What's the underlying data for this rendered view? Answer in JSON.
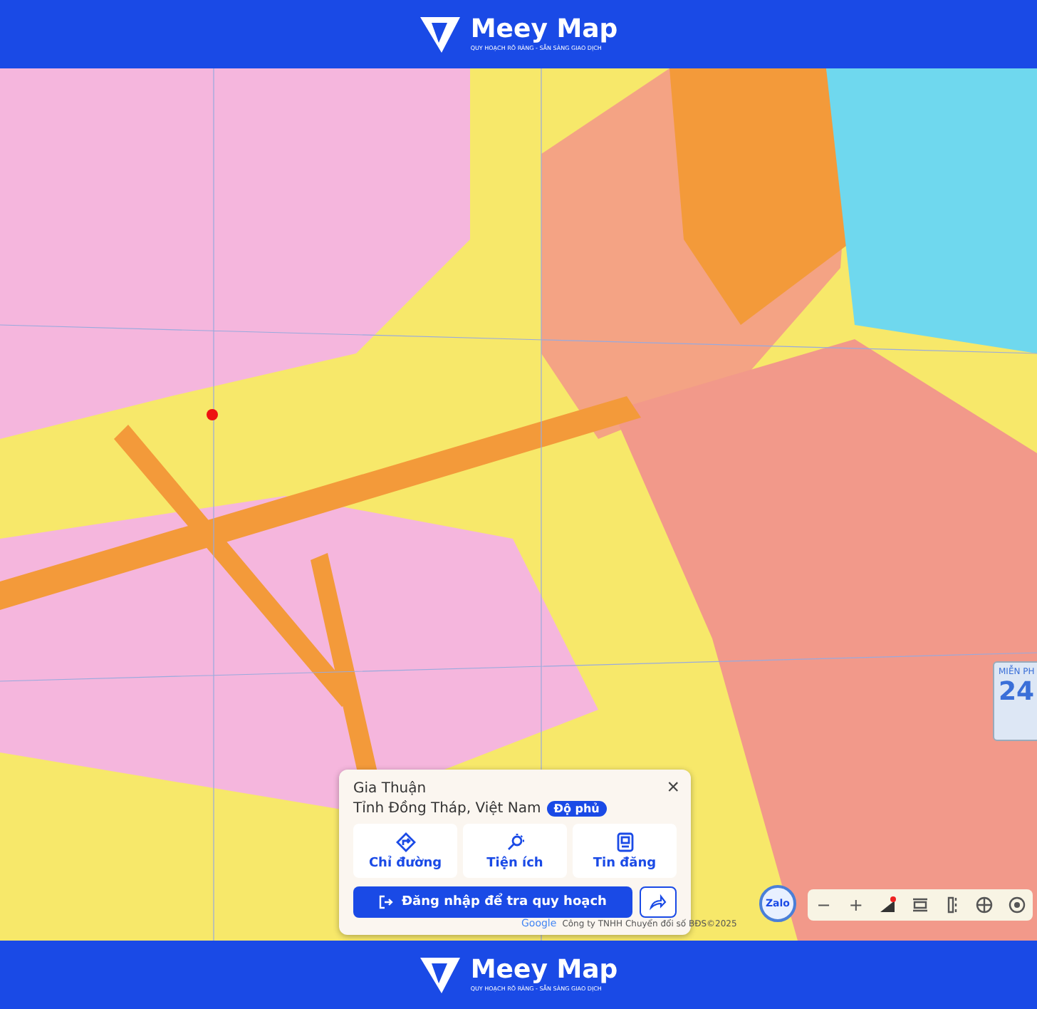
{
  "header": {
    "brand": "Meey Map",
    "tagline": "QUY HOẠCH RÕ RÀNG - SẴN SÀNG GIAO DỊCH"
  },
  "place_card": {
    "title": "Gia Thuận",
    "subtitle": "Tỉnh Đồng Tháp, Việt Nam",
    "badge": "Độ phủ",
    "close": "×",
    "actions": [
      {
        "kind": "directions",
        "label": "Chỉ đường"
      },
      {
        "kind": "utilities",
        "label": "Tiện ích"
      },
      {
        "kind": "listings",
        "label": "Tin đăng"
      }
    ],
    "login_button": "Đăng nhập để tra quy hoạch"
  },
  "attribution": {
    "provider": "Google",
    "copyright": "Công ty TNHH Chuyển đổi số BĐS©2025"
  },
  "zalo_button": "Zalo",
  "map_controls": [
    {
      "kind": "zoom-out",
      "label": "−"
    },
    {
      "kind": "zoom-in",
      "label": "+"
    },
    {
      "kind": "layers"
    },
    {
      "kind": "split"
    },
    {
      "kind": "compare"
    },
    {
      "kind": "globe"
    },
    {
      "kind": "locate"
    }
  ],
  "promo": {
    "headline": "MIỄN PH",
    "number": "24"
  },
  "footer": {
    "brand": "Meey Map",
    "tagline": "QUY HOẠCH RÕ RÀNG - SẴN SÀNG GIAO DỊCH"
  }
}
